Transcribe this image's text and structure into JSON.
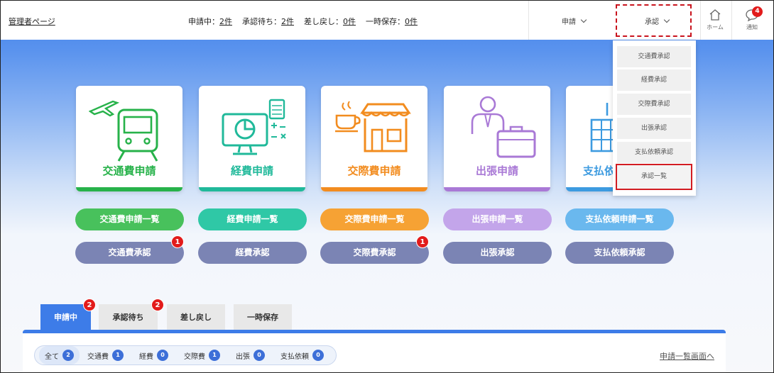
{
  "header": {
    "admin_link": "管理者ページ",
    "status": [
      {
        "label": "申請中：",
        "count": "2件"
      },
      {
        "label": "承認待ち：",
        "count": "2件"
      },
      {
        "label": "差し戻し：",
        "count": "0件"
      },
      {
        "label": "一時保存：",
        "count": "0件"
      }
    ],
    "menu_apply": "申請",
    "menu_approve": "承認",
    "home_label": "ホーム",
    "notify_label": "通知",
    "notify_badge": "4"
  },
  "dropdown": {
    "items": [
      "交通費承認",
      "経費承認",
      "交際費承認",
      "出張承認",
      "支払依頼承認",
      "承認一覧"
    ]
  },
  "cards": [
    {
      "title": "交通費申請",
      "color": "#27b24a"
    },
    {
      "title": "経費申請",
      "color": "#20b99a"
    },
    {
      "title": "交際費申請",
      "color": "#f28c1f"
    },
    {
      "title": "出張申請",
      "color": "#a979d6"
    },
    {
      "title": "支払依",
      "color": "#3d9be0"
    }
  ],
  "list_buttons": [
    {
      "label": "交通費申請一覧",
      "color": "#48c15c"
    },
    {
      "label": "経費申請一覧",
      "color": "#2fc8a6"
    },
    {
      "label": "交際費申請一覧",
      "color": "#f6a234"
    },
    {
      "label": "出張申請一覧",
      "color": "#c3a5ea"
    },
    {
      "label": "支払依頼申請一覧",
      "color": "#6ab8ee"
    }
  ],
  "approve_buttons": [
    {
      "label": "交通費承認",
      "badge": "1"
    },
    {
      "label": "経費承認",
      "badge": ""
    },
    {
      "label": "交際費承認",
      "badge": "1"
    },
    {
      "label": "出張承認",
      "badge": ""
    },
    {
      "label": "支払依頼承認",
      "badge": ""
    }
  ],
  "approve_color": "#7b84b4",
  "tabs": [
    {
      "label": "申請中",
      "badge": "2"
    },
    {
      "label": "承認待ち",
      "badge": "2"
    },
    {
      "label": "差し戻し",
      "badge": ""
    },
    {
      "label": "一時保存",
      "badge": ""
    }
  ],
  "filters": [
    {
      "label": "全て",
      "count": "2"
    },
    {
      "label": "交通費",
      "count": "1"
    },
    {
      "label": "経費",
      "count": "0"
    },
    {
      "label": "交際費",
      "count": "1"
    },
    {
      "label": "出張",
      "count": "0"
    },
    {
      "label": "支払依頼",
      "count": "0"
    }
  ],
  "list_link": "申請一覧画面へ"
}
